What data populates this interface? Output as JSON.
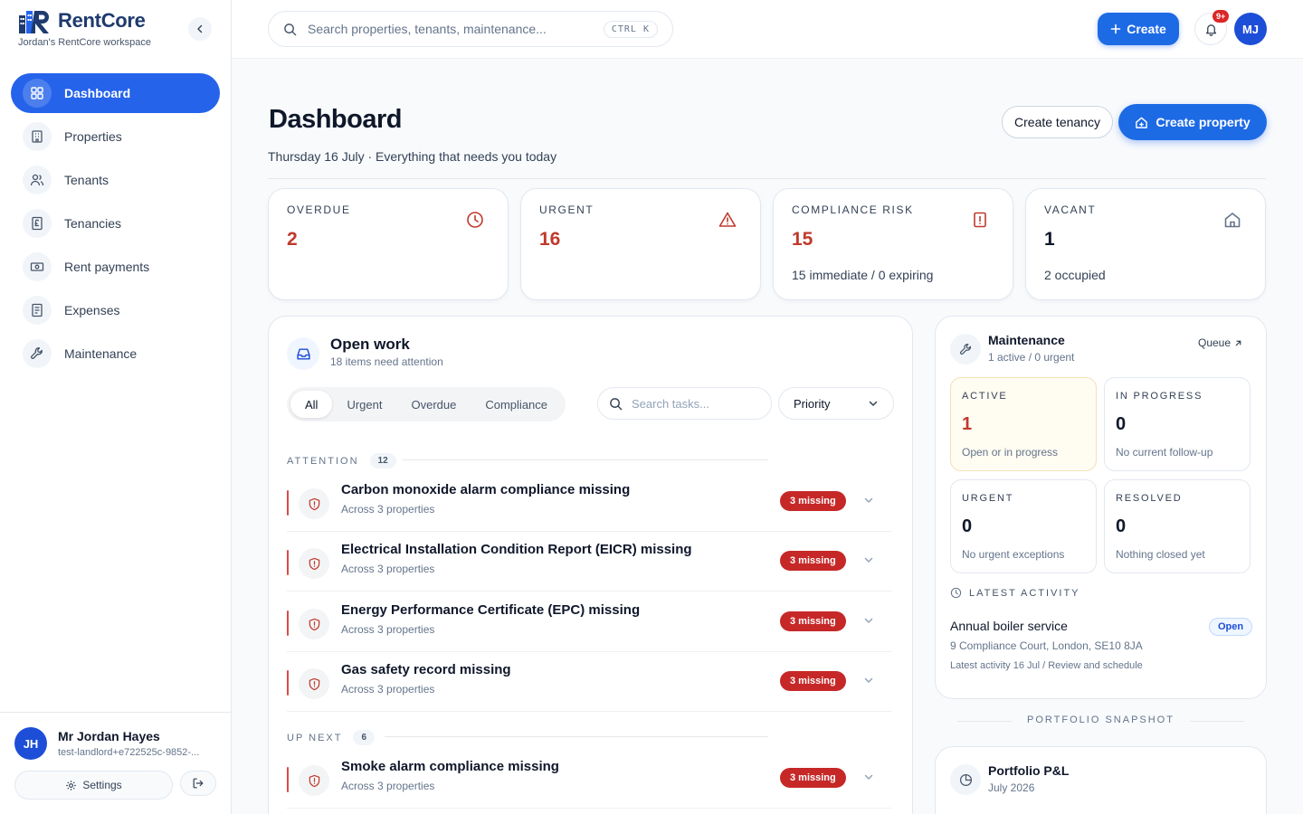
{
  "brand": {
    "name": "RentCore",
    "workspace": "Jordan's RentCore workspace"
  },
  "sidebar": {
    "items": [
      {
        "label": "Dashboard",
        "icon": "grid-icon",
        "active": true
      },
      {
        "label": "Properties",
        "icon": "building-icon"
      },
      {
        "label": "Tenants",
        "icon": "users-icon"
      },
      {
        "label": "Tenancies",
        "icon": "pound-document-icon"
      },
      {
        "label": "Rent payments",
        "icon": "banknote-icon"
      },
      {
        "label": "Expenses",
        "icon": "receipt-icon"
      },
      {
        "label": "Maintenance",
        "icon": "wrench-icon"
      }
    ],
    "user": {
      "initials": "JH",
      "name": "Mr Jordan Hayes",
      "email": "test-landlord+e722525c-9852-..."
    },
    "settings_label": "Settings"
  },
  "topbar": {
    "search_placeholder": "Search properties, tenants, maintenance...",
    "shortcut": "CTRL K",
    "create_label": "Create",
    "notifications_badge": "9+",
    "avatar_initials": "MJ"
  },
  "page": {
    "title": "Dashboard",
    "subtitle": "Thursday 16 July · Everything that needs you today",
    "create_tenancy_label": "Create tenancy",
    "create_property_label": "Create property"
  },
  "stats": [
    {
      "label": "OVERDUE",
      "value": "2",
      "sub": "",
      "icon": "clock-icon",
      "color": "#c0392b"
    },
    {
      "label": "URGENT",
      "value": "16",
      "sub": "",
      "icon": "warning-icon",
      "color": "#c0392b"
    },
    {
      "label": "COMPLIANCE RISK",
      "value": "15",
      "sub": "15 immediate / 0 expiring",
      "icon": "alert-document-icon",
      "color": "#c0392b"
    },
    {
      "label": "VACANT",
      "value": "1",
      "sub": "2 occupied",
      "icon": "home-icon",
      "color": "#0f172a"
    }
  ],
  "open_work": {
    "title": "Open work",
    "subtitle": "18 items need attention",
    "tabs": [
      "All",
      "Urgent",
      "Overdue",
      "Compliance"
    ],
    "search_placeholder": "Search tasks...",
    "priority_label": "Priority",
    "attention": {
      "label": "ATTENTION",
      "count": "12",
      "items": [
        {
          "title": "Carbon monoxide alarm compliance missing",
          "sub": "Across 3 properties",
          "badge": "3 missing"
        },
        {
          "title": "Electrical Installation Condition Report (EICR) missing",
          "sub": "Across 3 properties",
          "badge": "3 missing"
        },
        {
          "title": "Energy Performance Certificate (EPC) missing",
          "sub": "Across 3 properties",
          "badge": "3 missing"
        },
        {
          "title": "Gas safety record missing",
          "sub": "Across 3 properties",
          "badge": "3 missing"
        }
      ]
    },
    "up_next": {
      "label": "UP NEXT",
      "count": "6",
      "items": [
        {
          "title": "Smoke alarm compliance missing",
          "sub": "Across 3 properties",
          "badge": "3 missing"
        }
      ]
    }
  },
  "maintenance": {
    "title": "Maintenance",
    "subtitle": "1 active / 0 urgent",
    "queue_label": "Queue",
    "cells": [
      {
        "label": "ACTIVE",
        "value": "1",
        "sub": "Open or in progress",
        "color": "#c0392b"
      },
      {
        "label": "IN PROGRESS",
        "value": "0",
        "sub": "No current follow-up",
        "color": "#0f172a"
      },
      {
        "label": "URGENT",
        "value": "0",
        "sub": "No urgent exceptions",
        "color": "#0f172a"
      },
      {
        "label": "RESOLVED",
        "value": "0",
        "sub": "Nothing closed yet",
        "color": "#0f172a"
      }
    ],
    "latest_label": "LATEST ACTIVITY",
    "activity": {
      "title": "Annual boiler service",
      "status": "Open",
      "address": "9 Compliance Court, London, SE10 8JA",
      "latest": "Latest activity 16 Jul / Review and schedule"
    }
  },
  "snapshot_label": "PORTFOLIO SNAPSHOT",
  "pnl": {
    "title": "Portfolio P&L",
    "period": "July 2026"
  }
}
